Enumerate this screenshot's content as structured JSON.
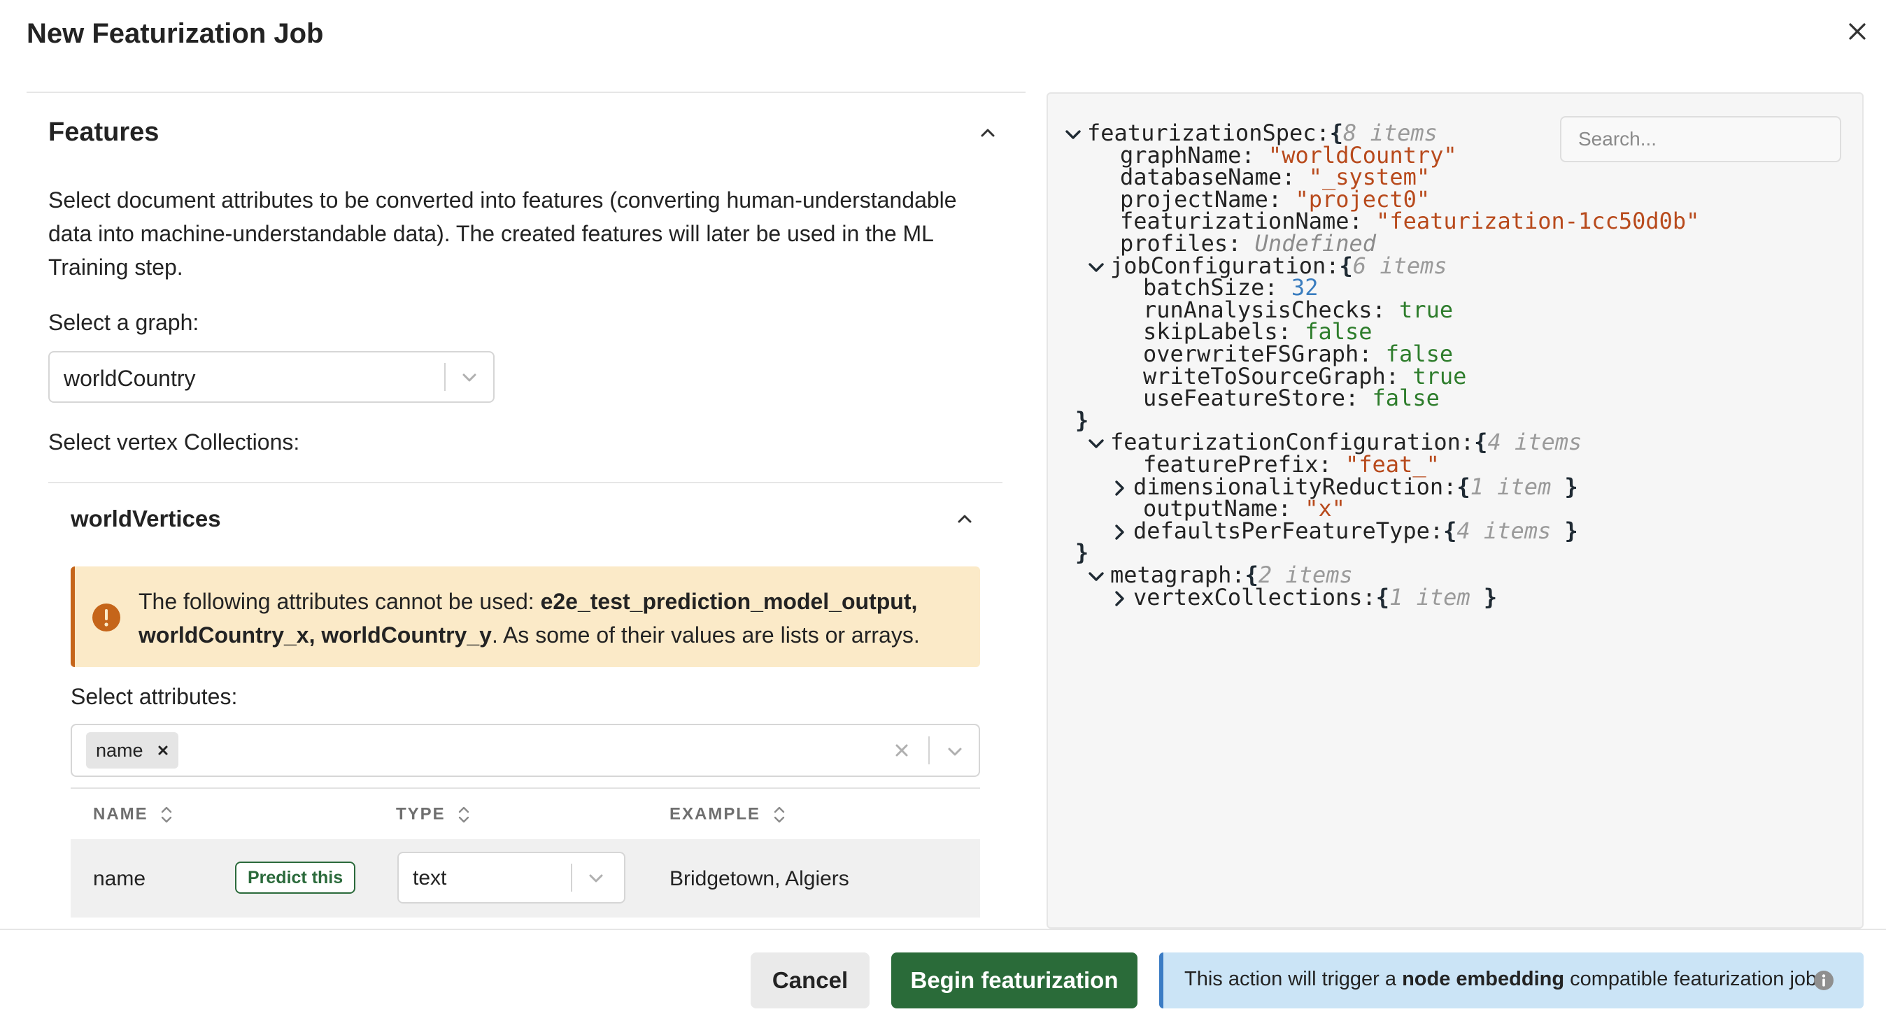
{
  "modal": {
    "title": "New Featurization Job"
  },
  "features": {
    "heading": "Features",
    "description": "Select document attributes to be converted into features (converting human-understandable data into machine-understandable data). The created features will later be used in the ML Training step.",
    "graph_label": "Select a graph:",
    "graph_value": "worldCountry",
    "vertex_label": "Select vertex Collections:"
  },
  "collection": {
    "title": "worldVertices",
    "warning": {
      "prefix": "The following attributes cannot be used: ",
      "attributes": "e2e_test_prediction_model_output, worldCountry_x, worldCountry_y",
      "suffix": ". As some of their values are lists or arrays."
    },
    "attrs_label": "Select attributes:",
    "selected_chip": "name",
    "table": {
      "columns": [
        "NAME",
        "TYPE",
        "EXAMPLE"
      ],
      "rows": [
        {
          "name": "name",
          "predict_label": "Predict this",
          "type": "text",
          "example": "Bridgetown, Algiers"
        }
      ]
    }
  },
  "json_view": {
    "search_placeholder": "Search...",
    "lines": [
      {
        "indent": 0,
        "expander": "open",
        "key": "featurizationSpec",
        "open": "{",
        "count": "8 items"
      },
      {
        "indent": 1,
        "key": "graphName",
        "value": "\"worldCountry\"",
        "vtype": "string"
      },
      {
        "indent": 1,
        "key": "databaseName",
        "value": "\"_system\"",
        "vtype": "string"
      },
      {
        "indent": 1,
        "key": "projectName",
        "value": "\"project0\"",
        "vtype": "string"
      },
      {
        "indent": 1,
        "key": "featurizationName",
        "value": "\"featurization-1cc50d0b\"",
        "vtype": "string"
      },
      {
        "indent": 1,
        "key": "profiles",
        "value": "Undefined",
        "vtype": "undefined"
      },
      {
        "indent": 1,
        "expander": "open",
        "key": "jobConfiguration",
        "open": "{",
        "count": "6 items"
      },
      {
        "indent": 2,
        "key": "batchSize",
        "value": "32",
        "vtype": "number"
      },
      {
        "indent": 2,
        "key": "runAnalysisChecks",
        "value": "true",
        "vtype": "boolean"
      },
      {
        "indent": 2,
        "key": "skipLabels",
        "value": "false",
        "vtype": "boolean"
      },
      {
        "indent": 2,
        "key": "overwriteFSGraph",
        "value": "false",
        "vtype": "boolean"
      },
      {
        "indent": 2,
        "key": "writeToSourceGraph",
        "value": "true",
        "vtype": "boolean"
      },
      {
        "indent": 2,
        "key": "useFeatureStore",
        "value": "false",
        "vtype": "boolean"
      },
      {
        "indent": 1,
        "closing": "}"
      },
      {
        "indent": 1,
        "expander": "open",
        "key": "featurizationConfiguration",
        "open": "{",
        "count": "4 items"
      },
      {
        "indent": 2,
        "key": "featurePrefix",
        "value": "\"feat_\"",
        "vtype": "string"
      },
      {
        "indent": 2,
        "expander": "closed",
        "key": "dimensionalityReduction",
        "open": "{",
        "count": "1 item",
        "close": "}"
      },
      {
        "indent": 2,
        "key": "outputName",
        "value": "\"x\"",
        "vtype": "string"
      },
      {
        "indent": 2,
        "expander": "closed",
        "key": "defaultsPerFeatureType",
        "open": "{",
        "count": "4 items",
        "close": "}"
      },
      {
        "indent": 1,
        "closing": "}"
      },
      {
        "indent": 1,
        "expander": "open",
        "key": "metagraph",
        "open": "{",
        "count": "2 items"
      },
      {
        "indent": 2,
        "expander": "closed",
        "key": "vertexCollections",
        "open": "{",
        "count": "1 item",
        "close": "}"
      }
    ]
  },
  "footer": {
    "cancel_label": "Cancel",
    "begin_label": "Begin featurization",
    "info": {
      "prefix": "This action will trigger a ",
      "emphasis": "node embedding",
      "suffix": " compatible featurization job."
    }
  },
  "colors": {
    "primary": "#2a6b39",
    "warning_bg": "#fbeac8",
    "warning_accent": "#c5651a",
    "info_bg": "#cbe4f6",
    "info_accent": "#3b7cc4",
    "json_string": "#b84a1c",
    "json_number": "#3a7dbf",
    "json_boolean": "#2e7d2c"
  },
  "icons": {
    "close": "close-icon",
    "collapse": "chevron-up-icon",
    "dropdown": "chevron-down-icon",
    "warning": "exclamation-circle-icon",
    "sort": "sort-icon",
    "tree_open": "chevron-down-icon",
    "tree_closed": "chevron-right-icon",
    "info": "info-circle-icon"
  }
}
